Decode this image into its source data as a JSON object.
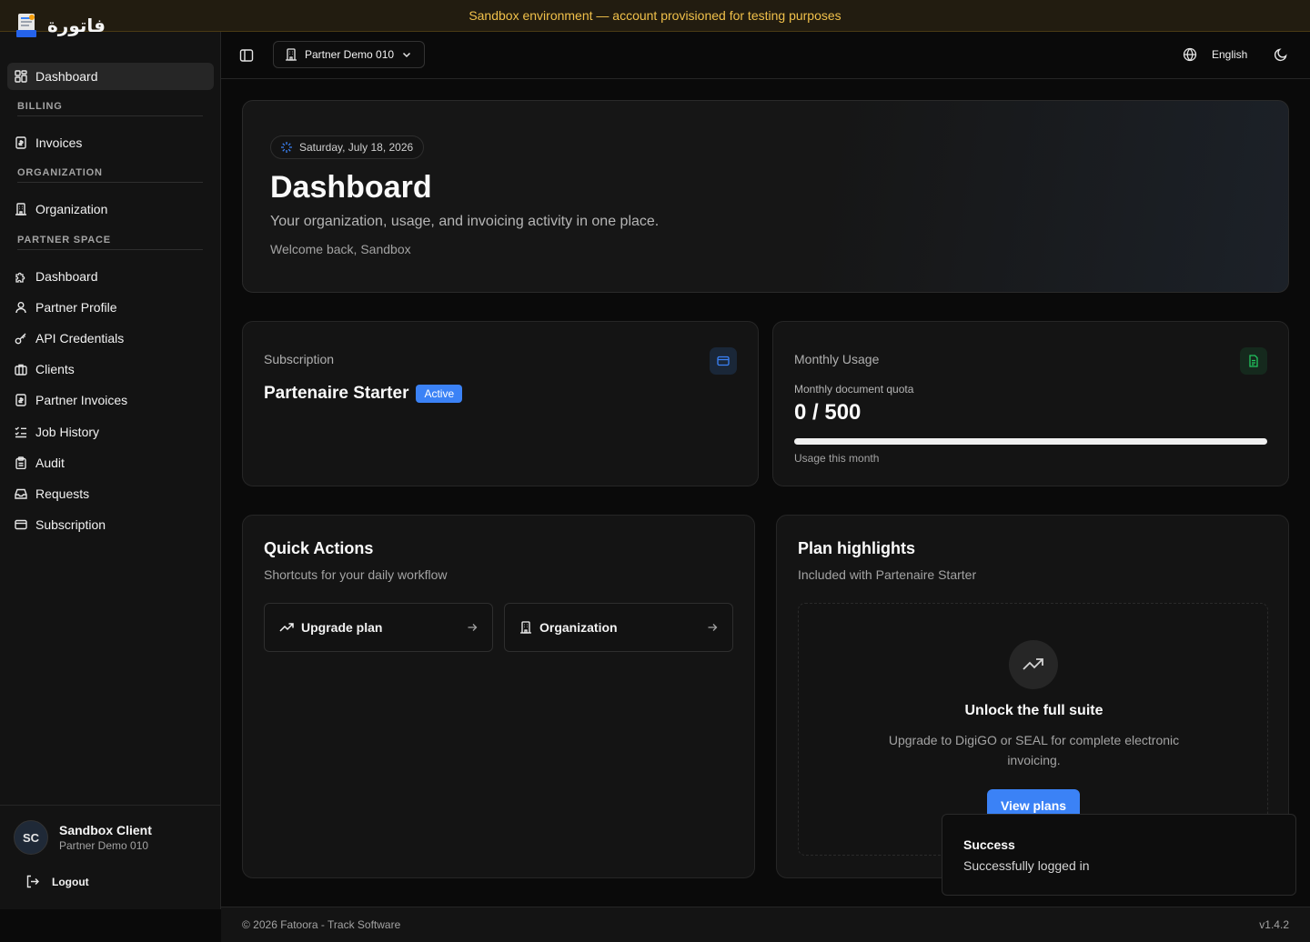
{
  "banner": {
    "text": "Sandbox environment — account provisioned for testing purposes"
  },
  "brand": {
    "name": "فاتورة",
    "logo_icon": "document-logo-icon"
  },
  "sidebar": {
    "items": [
      {
        "label": "Dashboard",
        "icon": "grid-icon",
        "active": true
      }
    ],
    "sections": [
      {
        "label": "BILLING",
        "items": [
          {
            "label": "Invoices",
            "icon": "invoice-icon"
          }
        ]
      },
      {
        "label": "ORGANIZATION",
        "items": [
          {
            "label": "Organization",
            "icon": "building-icon"
          }
        ]
      },
      {
        "label": "PARTNER SPACE",
        "items": [
          {
            "label": "Dashboard",
            "icon": "puzzle-icon"
          },
          {
            "label": "Partner Profile",
            "icon": "user-icon"
          },
          {
            "label": "API Credentials",
            "icon": "key-icon"
          },
          {
            "label": "Clients",
            "icon": "briefcase-icon"
          },
          {
            "label": "Partner Invoices",
            "icon": "invoice-icon"
          },
          {
            "label": "Job History",
            "icon": "list-checks-icon"
          },
          {
            "label": "Audit",
            "icon": "clipboard-icon"
          },
          {
            "label": "Requests",
            "icon": "inbox-icon"
          },
          {
            "label": "Subscription",
            "icon": "credit-card-icon"
          }
        ]
      }
    ]
  },
  "user": {
    "initials": "SC",
    "name": "Sandbox Client",
    "org": "Partner Demo 010",
    "logout_label": "Logout"
  },
  "topbar": {
    "org_switcher": "Partner Demo 010",
    "language": "English"
  },
  "hero": {
    "date": "Saturday, July 18, 2026",
    "title": "Dashboard",
    "subtitle": "Your organization, usage, and invoicing activity in one place.",
    "welcome": "Welcome back, Sandbox"
  },
  "subscription": {
    "label": "Subscription",
    "plan": "Partenaire Starter",
    "status": "Active"
  },
  "usage": {
    "label": "Monthly Usage",
    "quota_label": "Monthly document quota",
    "quota_value": "0 / 500",
    "used": 0,
    "total": 500,
    "note": "Usage this month"
  },
  "quick_actions": {
    "title": "Quick Actions",
    "subtitle": "Shortcuts for your daily workflow",
    "buttons": [
      {
        "label": "Upgrade plan",
        "icon": "trending-up-icon"
      },
      {
        "label": "Organization",
        "icon": "building-icon"
      }
    ]
  },
  "plan_highlights": {
    "title": "Plan highlights",
    "subtitle": "Included with Partenaire Starter",
    "empty_title": "Unlock the full suite",
    "empty_desc": "Upgrade to DigiGO or SEAL for complete electronic invoicing.",
    "cta": "View plans"
  },
  "toast": {
    "title": "Success",
    "message": "Successfully logged in"
  },
  "footer": {
    "copyright": "© 2026 Fatoora - Track Software",
    "version": "v1.4.2"
  },
  "colors": {
    "accent": "#3b82f6",
    "banner_text": "#f0c04a",
    "success_icon": "#22c55e"
  }
}
